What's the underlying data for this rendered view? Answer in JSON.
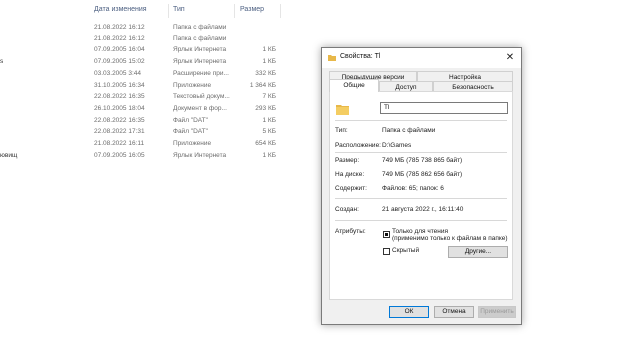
{
  "explorer": {
    "columns": {
      "date": "Дата изменения",
      "type": "Тип",
      "size": "Размер"
    },
    "rows": [
      {
        "name": "",
        "date": "21.08.2022 16:12",
        "type": "Папка с файлами",
        "size": ""
      },
      {
        "name": "",
        "date": "21.08.2022 16:12",
        "type": "Папка с файлами",
        "size": ""
      },
      {
        "name": "",
        "date": "07.09.2005 16:04",
        "type": "Ярлык Интернета",
        "size": "1 КБ"
      },
      {
        "name": "s",
        "date": "07.09.2005 15:02",
        "type": "Ярлык Интернета",
        "size": "1 КБ"
      },
      {
        "name": "",
        "date": "03.03.2005 3:44",
        "type": "Расширение при...",
        "size": "332 КБ"
      },
      {
        "name": "",
        "date": "31.10.2005 16:34",
        "type": "Приложение",
        "size": "1 364 КБ"
      },
      {
        "name": "",
        "date": "22.08.2022 16:35",
        "type": "Текстовый докум...",
        "size": "7 КБ"
      },
      {
        "name": "",
        "date": "26.10.2005 18:04",
        "type": "Документ в фор...",
        "size": "293 КБ"
      },
      {
        "name": "",
        "date": "22.08.2022 16:35",
        "type": "Файл \"DAT\"",
        "size": "1 КБ"
      },
      {
        "name": "",
        "date": "22.08.2022 17:31",
        "type": "Файл \"DAT\"",
        "size": "5 КБ"
      },
      {
        "name": "",
        "date": "21.08.2022 16:11",
        "type": "Приложение",
        "size": "654 КБ"
      },
      {
        "name": "ювищ",
        "date": "07.09.2005 16:05",
        "type": "Ярлык Интернета",
        "size": "1 КБ"
      }
    ]
  },
  "dialog": {
    "title": "Свойства: Tl",
    "close": "✕",
    "tabs_top": [
      "Предыдущие версии",
      "Настройка"
    ],
    "tabs_bottom": [
      "Общие",
      "Доступ",
      "Безопасность"
    ],
    "name_value": "Tl",
    "info": {
      "type_label": "Тип:",
      "type_value": "Папка с файлами",
      "location_label": "Расположение:",
      "location_value": "D:\\Games",
      "size_label": "Размер:",
      "size_value": "749 МБ (785 738 865 байт)",
      "disk_label": "На диске:",
      "disk_value": "749 МБ (785 862 656 байт)",
      "contains_label": "Содержит:",
      "contains_value": "Файлов: 65; папок: 6",
      "created_label": "Создан:",
      "created_value": "21 августа 2022 г., 16:11:40",
      "attributes_label": "Атрибуты:"
    },
    "attributes": {
      "readonly_label": "Только для чтения\n(применимо только к файлам в папке)",
      "readonly_line1": "Только для чтения",
      "readonly_line2": "(применимо только к файлам в папке)",
      "hidden_label": "Скрытый",
      "other_button": "Другие..."
    },
    "buttons": {
      "ok": "ОК",
      "cancel": "Отмена",
      "apply": "Применить"
    },
    "colors": {
      "folder": "#e8b84a",
      "accent": "#0078d7"
    }
  }
}
